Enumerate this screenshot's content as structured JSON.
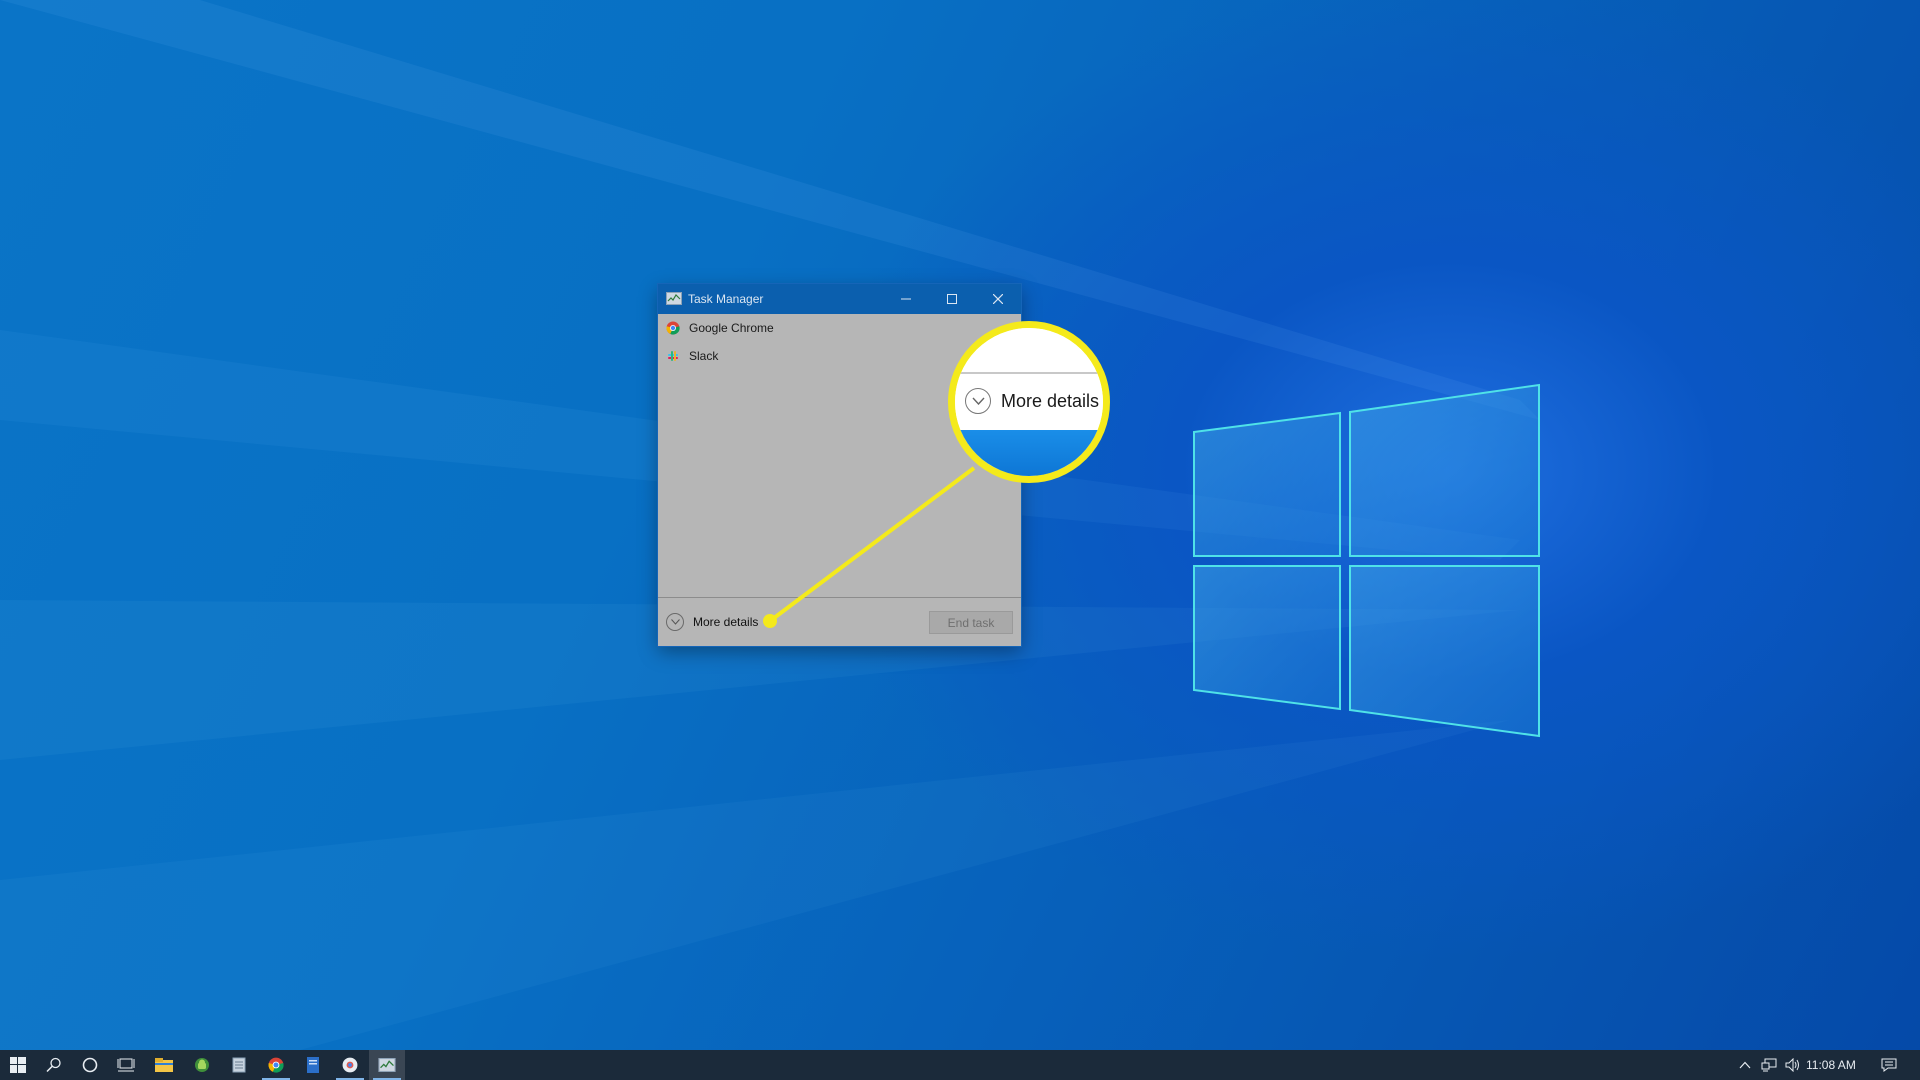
{
  "window": {
    "title": "Task Manager",
    "minimize_icon": "minimize-icon",
    "maximize_icon": "maximize-icon",
    "close_icon": "close-icon"
  },
  "processes": [
    {
      "name": "Google Chrome",
      "icon": "chrome-icon"
    },
    {
      "name": "Slack",
      "icon": "slack-icon"
    }
  ],
  "footer": {
    "more_details_label": "More details",
    "end_task_label": "End task"
  },
  "callout": {
    "label": "More details",
    "color": "#f4ea1b"
  },
  "taskbar": {
    "items": [
      "start-icon",
      "search-icon",
      "cortana-icon",
      "task-view-icon",
      "file-explorer-icon",
      "android-app-icon",
      "notepad-icon",
      "chrome-icon",
      "word-icon",
      "chrome-beta-icon",
      "task-manager-icon"
    ],
    "clock": "11:08 AM",
    "tray": [
      "show-hidden-icons-icon",
      "network-icon",
      "volume-icon",
      "action-center-icon"
    ]
  },
  "colors": {
    "titlebar": "#0b5fae",
    "taskbar": "#1b2a3a",
    "window_body": "#b6b6b6"
  }
}
